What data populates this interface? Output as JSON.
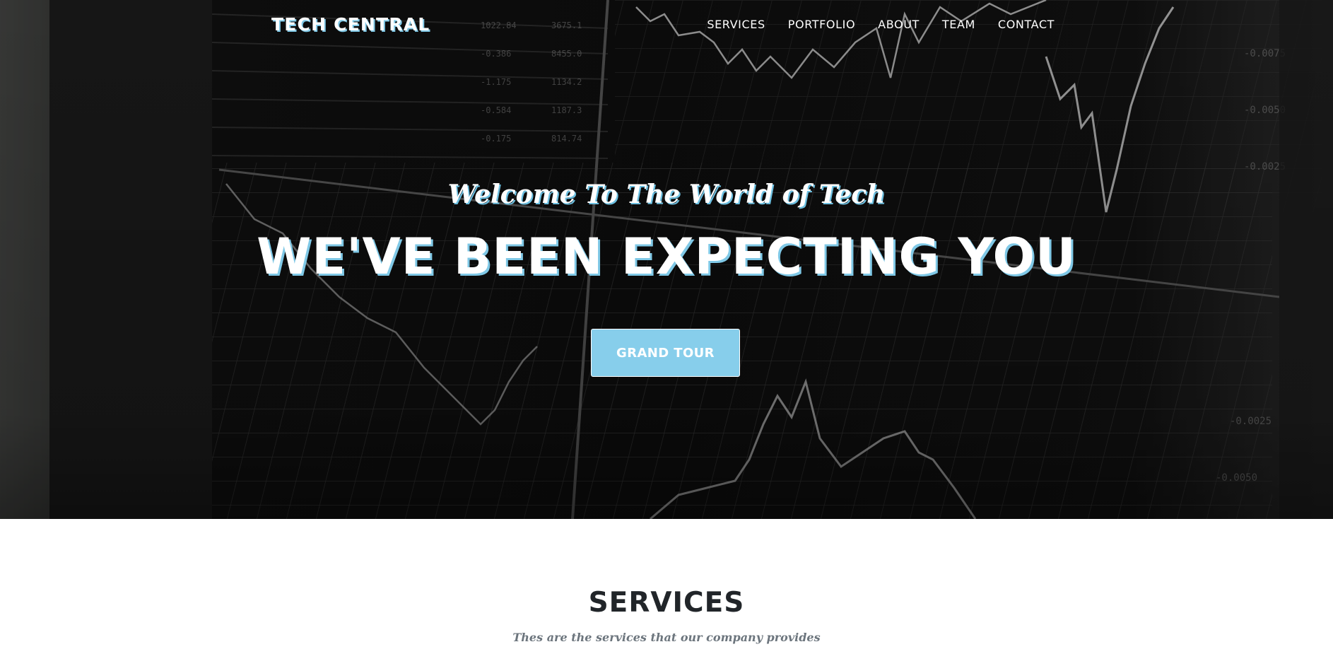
{
  "navbar": {
    "brand": "TECH CENTRAL",
    "links": [
      {
        "label": "SERVICES"
      },
      {
        "label": "PORTFOLIO"
      },
      {
        "label": "ABOUT"
      },
      {
        "label": "TEAM"
      },
      {
        "label": "CONTACT"
      }
    ]
  },
  "hero": {
    "subheading": "Welcome To The World of Tech",
    "heading": "WE'VE BEEN EXPECTING YOU",
    "button_label": "GRAND TOUR",
    "background_image": "stock-market-charts-screen"
  },
  "services": {
    "heading": "SERVICES",
    "subheading": "Thes are the services that our company provides"
  },
  "colors": {
    "accent": "#87ceeb",
    "text_shadow": "#7fc8e6",
    "heading_dark": "#212529",
    "muted": "#6c757d"
  }
}
